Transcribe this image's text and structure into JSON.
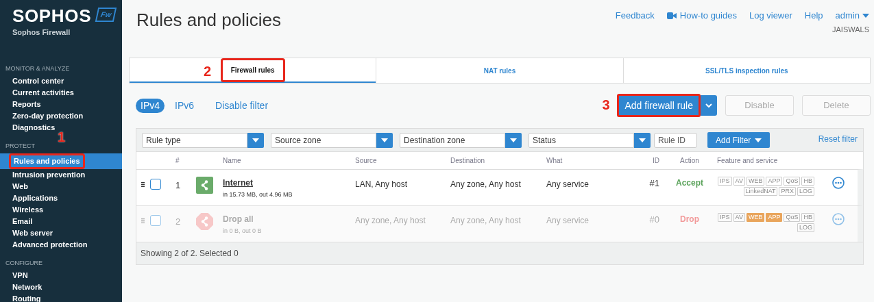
{
  "brand": {
    "name": "SOPHOS",
    "badge": "Fw",
    "product": "Sophos Firewall"
  },
  "sidebar": [
    {
      "title": "MONITOR & ANALYZE",
      "items": [
        {
          "label": "Control center",
          "selected": false
        },
        {
          "label": "Current activities",
          "selected": false
        },
        {
          "label": "Reports",
          "selected": false
        },
        {
          "label": "Zero-day protection",
          "selected": false
        },
        {
          "label": "Diagnostics",
          "selected": false
        }
      ]
    },
    {
      "title": "PROTECT",
      "items": [
        {
          "label": "Rules and policies",
          "selected": true,
          "callout": "1"
        },
        {
          "label": "Intrusion prevention",
          "selected": false
        },
        {
          "label": "Web",
          "selected": false
        },
        {
          "label": "Applications",
          "selected": false
        },
        {
          "label": "Wireless",
          "selected": false
        },
        {
          "label": "Email",
          "selected": false
        },
        {
          "label": "Web server",
          "selected": false
        },
        {
          "label": "Advanced protection",
          "selected": false
        }
      ]
    },
    {
      "title": "CONFIGURE",
      "items": [
        {
          "label": "VPN",
          "selected": false
        },
        {
          "label": "Network",
          "selected": false
        },
        {
          "label": "Routing",
          "selected": false
        }
      ]
    }
  ],
  "page_title": "Rules and policies",
  "top_links": [
    "Feedback",
    "How-to guides",
    "Log viewer",
    "Help"
  ],
  "user": {
    "name": "admin",
    "org": "JAISWALS"
  },
  "tabs": [
    {
      "label": "Firewall rules",
      "selected": true,
      "callout": "2"
    },
    {
      "label": "NAT rules",
      "selected": false
    },
    {
      "label": "SSL/TLS inspection rules",
      "selected": false
    }
  ],
  "ip_toggle": [
    {
      "label": "IPv4",
      "selected": true
    },
    {
      "label": "IPv6",
      "selected": false
    }
  ],
  "disable_filter": "Disable filter",
  "add_button": {
    "label": "Add firewall rule",
    "callout": "3"
  },
  "actions": [
    {
      "label": "Disable",
      "disabled": true
    },
    {
      "label": "Delete",
      "disabled": true
    }
  ],
  "filters": [
    {
      "placeholder": "Rule type"
    },
    {
      "placeholder": "Source zone"
    },
    {
      "placeholder": "Destination zone"
    },
    {
      "placeholder": "Status"
    }
  ],
  "rule_id": {
    "placeholder": "Rule ID"
  },
  "add_filter": "Add Filter",
  "reset_filter": "Reset filter",
  "table": {
    "columns": [
      "#",
      "Name",
      "Source",
      "Destination",
      "What",
      "ID",
      "Action",
      "Feature and service"
    ],
    "rows": [
      {
        "num": "1",
        "name": "Internet",
        "traffic": "in 15.73 MB, out 4.96 MB",
        "source": "LAN, Any host",
        "destination": "Any zone, Any host",
        "what": "Any service",
        "id": "#1",
        "action": {
          "text": "Accept",
          "color": "#5ba35b"
        },
        "enabled": true,
        "checked": false,
        "features": [
          {
            "label": "IPS",
            "on": false
          },
          {
            "label": "AV",
            "on": false
          },
          {
            "label": "WEB",
            "on": false
          },
          {
            "label": "APP",
            "on": false
          },
          {
            "label": "QoS",
            "on": false
          },
          {
            "label": "HB",
            "on": false
          },
          {
            "label": "LinkedNAT",
            "on": false
          },
          {
            "label": "PRX",
            "on": false
          },
          {
            "label": "LOG",
            "on": false
          }
        ]
      },
      {
        "num": "2",
        "name": "Drop all",
        "traffic": "in 0 B, out 0 B",
        "source": "Any zone, Any host",
        "destination": "Any zone, Any host",
        "what": "Any service",
        "id": "#0",
        "action": {
          "text": "Drop",
          "color": "#f29a9a"
        },
        "enabled": false,
        "checked": false,
        "features": [
          {
            "label": "IPS",
            "on": false
          },
          {
            "label": "AV",
            "on": false
          },
          {
            "label": "WEB",
            "on": true
          },
          {
            "label": "APP",
            "on": true
          },
          {
            "label": "QoS",
            "on": false
          },
          {
            "label": "HB",
            "on": false
          },
          {
            "label": "LOG",
            "on": false
          }
        ]
      }
    ],
    "footer": "Showing 2 of 2. Selected 0"
  }
}
